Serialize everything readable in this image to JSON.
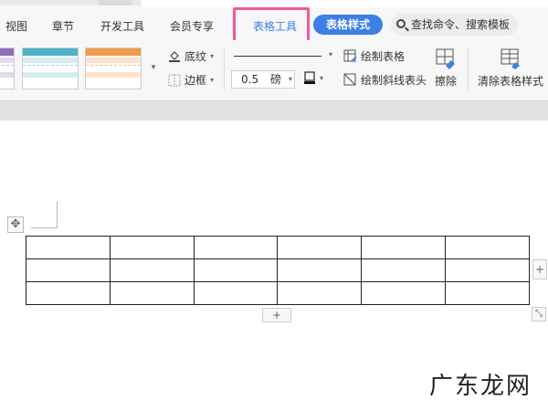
{
  "tabs": {
    "view": "视图",
    "chapter": "章节",
    "devtools": "开发工具",
    "member": "会员专享",
    "table_tools": "表格工具",
    "table_style": "表格样式"
  },
  "search": {
    "label": "查找命令、搜索模板"
  },
  "ribbon": {
    "shading": "底纹",
    "border": "边框",
    "line_width_value": "0.5",
    "line_width_unit": "磅",
    "draw_table": "绘制表格",
    "draw_diagonal_header": "绘制斜线表头",
    "erase": "擦除",
    "clear_table_style": "清除表格样式"
  },
  "gallery_colors": [
    "#8e6fb8",
    "#4db3c8",
    "#f09a4c"
  ],
  "accent": "#3d7fe4",
  "highlight_color": "#ef5b9c",
  "table": {
    "rows": 3,
    "cols": 6
  },
  "watermark": "广东龙网"
}
